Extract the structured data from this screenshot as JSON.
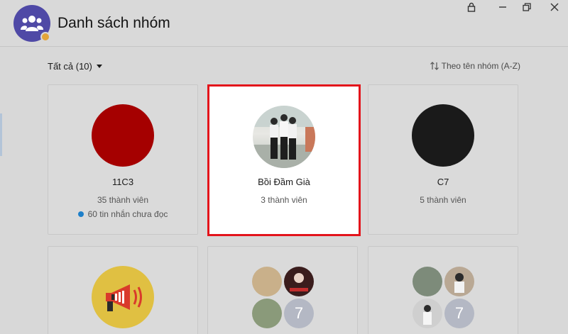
{
  "header": {
    "title": "Danh sách nhóm",
    "logo_icon": "group-icon",
    "logo_color": "#4f49a6"
  },
  "window_controls": [
    "lock-icon",
    "minimize-icon",
    "restore-icon",
    "close-icon"
  ],
  "toolbar": {
    "filter_label": "Tất cả (10)",
    "sort_label": "Theo tên nhóm (A-Z)"
  },
  "groups": [
    {
      "name": "11C3",
      "members": "35 thành viên",
      "unread": "60 tin nhắn chưa đọc",
      "avatar_color": "#a50000"
    },
    {
      "name": "Bồi Đầm Già",
      "members": "3 thành viên",
      "avatar": "group-photo",
      "selected": true
    },
    {
      "name": "C7",
      "members": "5 thành viên",
      "avatar_color": "#1a1a1a"
    },
    {
      "avatar": "megaphone-icon",
      "avatar_color": "#e0c042"
    },
    {
      "avatar": "member-collage",
      "extra_count": "7"
    },
    {
      "avatar": "member-collage",
      "extra_count": "7"
    }
  ],
  "colors": {
    "selected_border": "#e3141b",
    "unread_dot": "#1d7fc9"
  }
}
